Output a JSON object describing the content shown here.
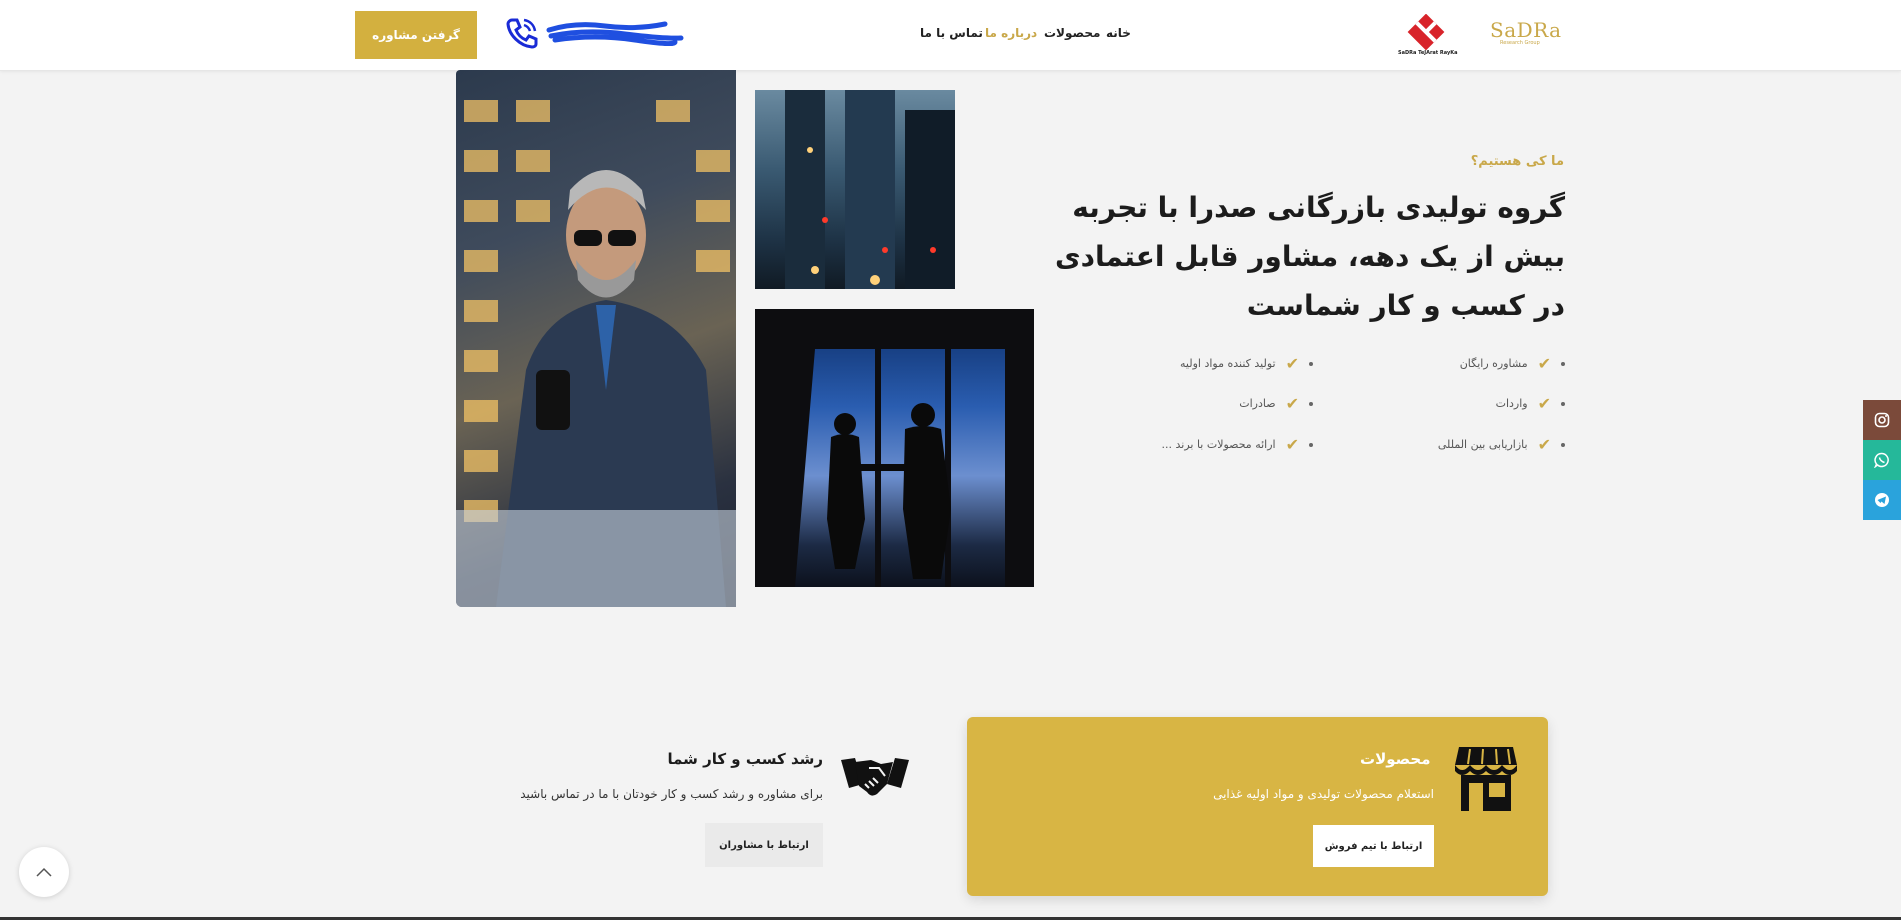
{
  "header": {
    "brand_name": "SaDRa",
    "brand_tagline": "Research Group",
    "logo_text": "SaDRa TeJArat RayKa",
    "nav": {
      "home": "خانه",
      "products": "محصولات",
      "about": "درباره ما",
      "contact": "تماس با ما"
    },
    "consult_button": "گرفتن مشاوره"
  },
  "hero": {
    "eyebrow": "ما کی هستیم؟",
    "headline": "گروه تولیدی بازرگانی صدرا با تجربه بیش از یک دهه، مشاور قابل اعتمادی در کسب و کار شماست",
    "features_col1": [
      "مشاوره رایگان",
      "واردات",
      "بازاریابی بین المللی"
    ],
    "features_col2": [
      "تولید کننده مواد اولیه",
      "صادرات",
      "ارائه محصولات با برند ..."
    ]
  },
  "cards": {
    "products": {
      "title": "محصولات",
      "text": "استعلام محصولات تولیدی و مواد اولیه غذایی",
      "button": "ارتباط با تیم فروش"
    },
    "growth": {
      "title": "رشد کسب و کار شما",
      "text": "برای مشاوره و رشد کسب و کار خودتان با ما در تماس باشید",
      "button": "ارتباط با مشاوران"
    }
  },
  "colors": {
    "accent": "#d3b03f",
    "instagram": "#7b4a3a",
    "whatsapp": "#25b89a",
    "telegram": "#2aa3dc"
  },
  "icons": [
    "phone-icon",
    "store-icon",
    "handshake-icon",
    "instagram-icon",
    "whatsapp-icon",
    "telegram-icon",
    "arrow-up-icon",
    "check-icon"
  ]
}
